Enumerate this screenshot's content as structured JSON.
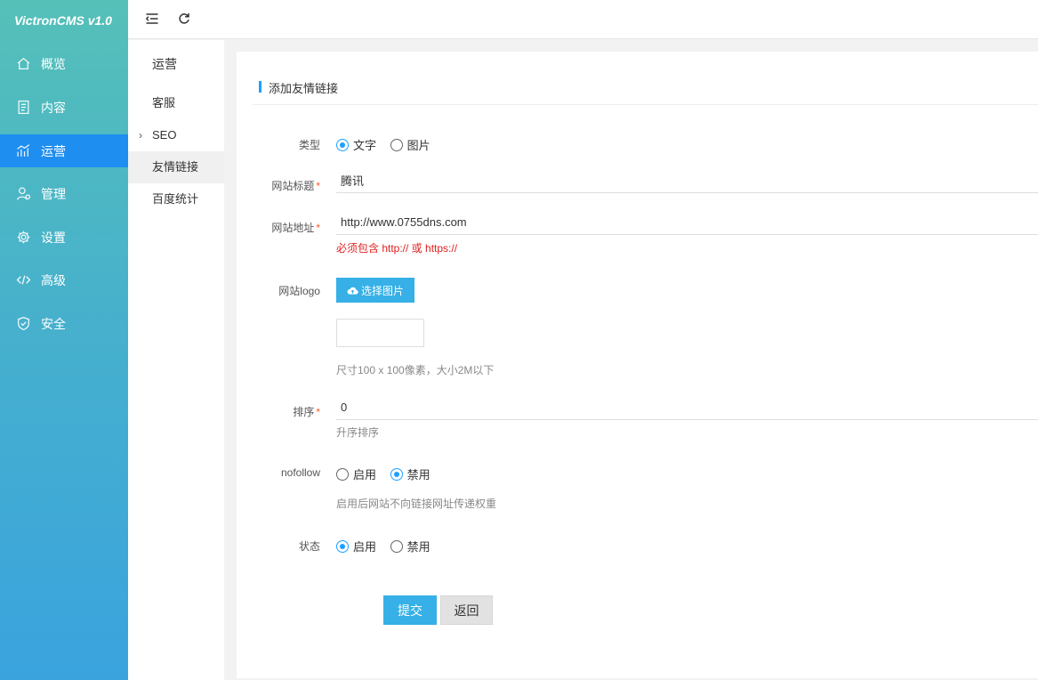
{
  "brand": "VictronCMS v1.0",
  "sidebar": {
    "items": [
      {
        "label": "概览",
        "icon": "home-icon"
      },
      {
        "label": "内容",
        "icon": "document-icon"
      },
      {
        "label": "运营",
        "icon": "chart-icon",
        "active": true
      },
      {
        "label": "管理",
        "icon": "user-icon"
      },
      {
        "label": "设置",
        "icon": "gear-icon"
      },
      {
        "label": "高级",
        "icon": "code-icon"
      },
      {
        "label": "安全",
        "icon": "shield-icon"
      }
    ]
  },
  "topbar": {
    "menu_toggle_icon": "menu-fold-icon",
    "refresh_icon": "refresh-icon"
  },
  "subnav": {
    "title": "运营",
    "items": [
      {
        "label": "客服"
      },
      {
        "label": "SEO",
        "expandable": true
      },
      {
        "label": "友情链接",
        "active": true
      },
      {
        "label": "百度统计"
      }
    ]
  },
  "form": {
    "heading": "添加友情链接",
    "type": {
      "label": "类型",
      "options": [
        "文字",
        "图片"
      ],
      "selected": "文字"
    },
    "site_title": {
      "label": "网站标题",
      "required_mark": "*",
      "value": "腾讯"
    },
    "site_url": {
      "label": "网站地址",
      "required_mark": "*",
      "value": "http://www.0755dns.com",
      "hint": "必须包含 http:// 或 https://"
    },
    "logo": {
      "label": "网站logo",
      "button": "选择图片",
      "hint": "尺寸100 x 100像素，大小2M以下"
    },
    "sort": {
      "label": "排序",
      "required_mark": "*",
      "value": "0",
      "hint": "升序排序"
    },
    "nofollow": {
      "label": "nofollow",
      "options": [
        "启用",
        "禁用"
      ],
      "selected": "禁用",
      "hint": "启用后网站不向链接网址传递权重"
    },
    "status": {
      "label": "状态",
      "options": [
        "启用",
        "禁用"
      ],
      "selected": "启用"
    },
    "submit": "提交",
    "back": "返回"
  },
  "colors": {
    "accent": "#1e9fff",
    "button": "#36b0e6",
    "active_nav": "#1e8ef0",
    "error": "#e02020"
  }
}
